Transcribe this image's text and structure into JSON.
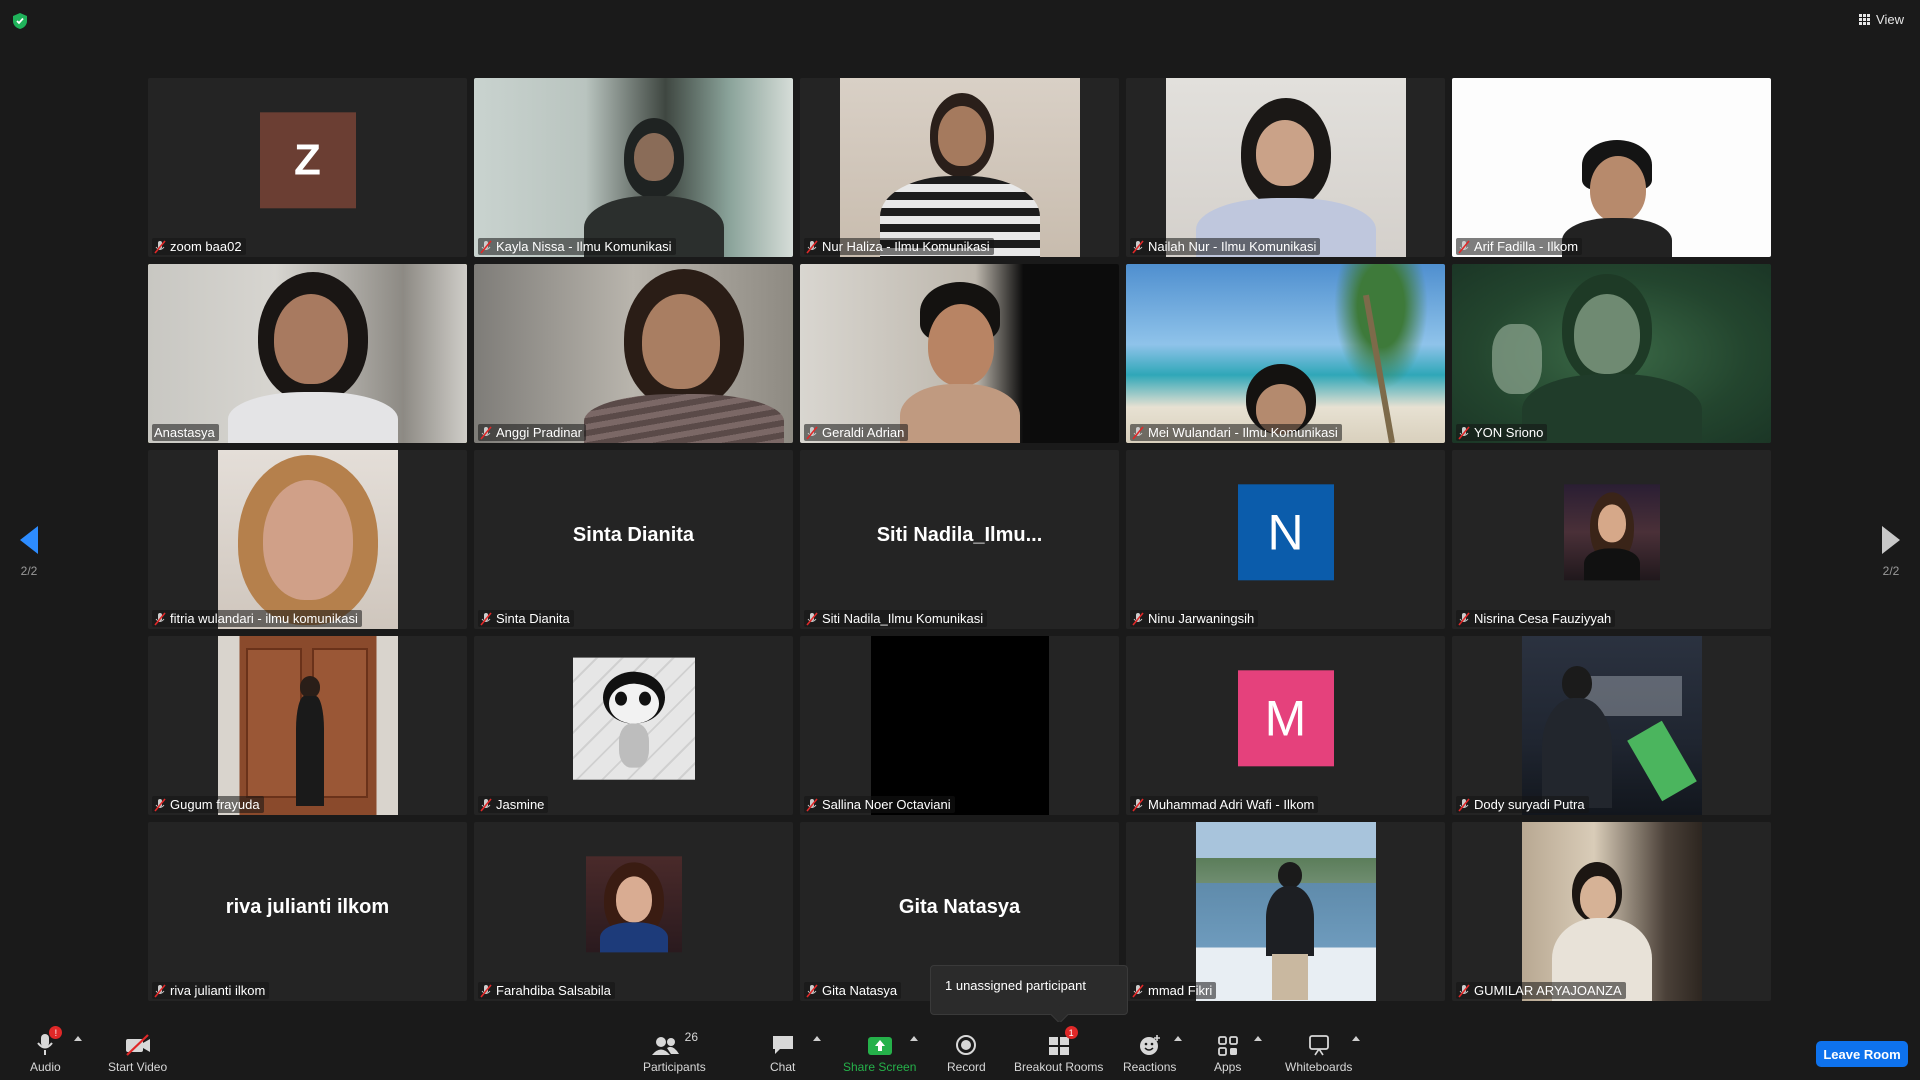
{
  "top": {
    "view_label": "View"
  },
  "navigation": {
    "page_left": "2/2",
    "page_right": "2/2"
  },
  "participants_tiles": [
    {
      "name": "zoom baa02",
      "avatar_letter": "Z",
      "avatar_color": "#6b3e33"
    },
    {
      "name": "Kayla Nissa - Ilmu Komunikasi"
    },
    {
      "name": "Nur Haliza - Ilmu Komunikasi"
    },
    {
      "name": "Nailah Nur - Ilmu Komunikasi"
    },
    {
      "name": "Arif Fadilla - Ilkom"
    },
    {
      "name": "Anastasya",
      "active_speaker": true
    },
    {
      "name": "Anggi Pradinar"
    },
    {
      "name": "Geraldi Adrian"
    },
    {
      "name": "Mei Wulandari - Ilmu Komunikasi"
    },
    {
      "name": "YON Sriono"
    },
    {
      "name": "fitria wulandari - ilmu komunikasi"
    },
    {
      "name": "Sinta Dianita",
      "display_name": "Sinta Dianita"
    },
    {
      "name": "Siti Nadila_Ilmu Komunikasi",
      "display_name": "Siti  Nadila_Ilmu..."
    },
    {
      "name": "Ninu Jarwaningsih",
      "avatar_letter": "N",
      "avatar_color": "#0b5cab"
    },
    {
      "name": "Nisrina Cesa Fauziyyah"
    },
    {
      "name": "Gugum frayuda"
    },
    {
      "name": "Jasmine"
    },
    {
      "name": "Sallina Noer Octaviani"
    },
    {
      "name": "Muhammad Adri Wafi - Ilkom",
      "avatar_letter": "M",
      "avatar_color": "#e5417c"
    },
    {
      "name": "Dody suryadi Putra"
    },
    {
      "name": "riva julianti ilkom",
      "display_name": "riva julianti ilkom"
    },
    {
      "name": "Farahdiba Salsabila"
    },
    {
      "name": "Gita Natasya",
      "display_name": "Gita Natasya"
    },
    {
      "name": "mmad Fikri"
    },
    {
      "name": "GUMILAR ARYAJOANZA"
    }
  ],
  "tooltip": {
    "text": "1 unassigned participant"
  },
  "toolbar": {
    "audio": "Audio",
    "audio_badge": "!",
    "start_video": "Start Video",
    "participants": "Participants",
    "participants_count": "26",
    "chat": "Chat",
    "share_screen": "Share Screen",
    "record": "Record",
    "breakout_rooms": "Breakout Rooms",
    "breakout_badge": "1",
    "reactions": "Reactions",
    "apps": "Apps",
    "whiteboards": "Whiteboards",
    "leave": "Leave Room"
  },
  "colors": {
    "accent": "#0e72ed",
    "active_border": "#d7d86a",
    "share_green": "#25b14a",
    "muted_red": "#e02828"
  }
}
